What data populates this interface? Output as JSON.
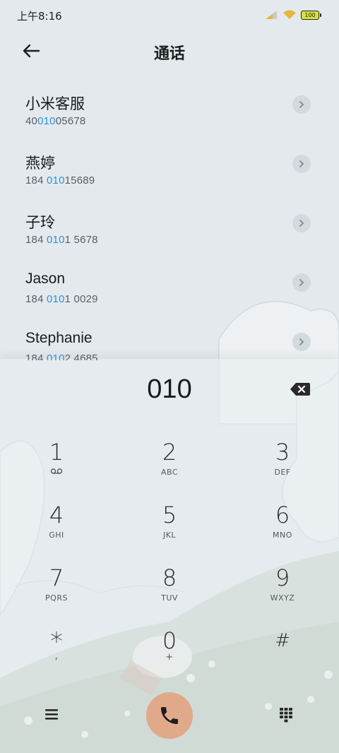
{
  "status_bar": {
    "time": "上午8:16",
    "battery": "100"
  },
  "header": {
    "title": "通话"
  },
  "contacts": [
    {
      "name": "小米客服",
      "number_pre": "40",
      "number_match": "010",
      "number_post": "05678"
    },
    {
      "name": "燕婷",
      "number_pre": "184 ",
      "number_match": "010",
      "number_post": "15689"
    },
    {
      "name": "子玲",
      "number_pre": "184 ",
      "number_match": "010",
      "number_post": "1 5678"
    },
    {
      "name": "Jason",
      "number_pre": "184 ",
      "number_match": "010",
      "number_post": "1 0029"
    },
    {
      "name": "Stephanie",
      "number_pre": "184 ",
      "number_match": "010",
      "number_post": "2 4685"
    }
  ],
  "dialer": {
    "entered_number": "010",
    "keys": [
      {
        "digit": "1",
        "letters": ""
      },
      {
        "digit": "2",
        "letters": "ABC"
      },
      {
        "digit": "3",
        "letters": "DEF"
      },
      {
        "digit": "4",
        "letters": "GHI"
      },
      {
        "digit": "5",
        "letters": "JKL"
      },
      {
        "digit": "6",
        "letters": "MNO"
      },
      {
        "digit": "7",
        "letters": "PQRS"
      },
      {
        "digit": "8",
        "letters": "TUV"
      },
      {
        "digit": "9",
        "letters": "WXYZ"
      },
      {
        "digit": "*",
        "letters": ","
      },
      {
        "digit": "0",
        "letters": "+"
      },
      {
        "digit": "#",
        "letters": ""
      }
    ]
  },
  "icons": {
    "back": "arrow-left-icon",
    "backspace": "backspace-icon",
    "voicemail": "voicemail-icon",
    "menu": "menu-icon",
    "call": "phone-icon",
    "keypad": "keypad-icon"
  },
  "colors": {
    "accent": "#2e93d8",
    "call_button": "#e0a98a"
  }
}
